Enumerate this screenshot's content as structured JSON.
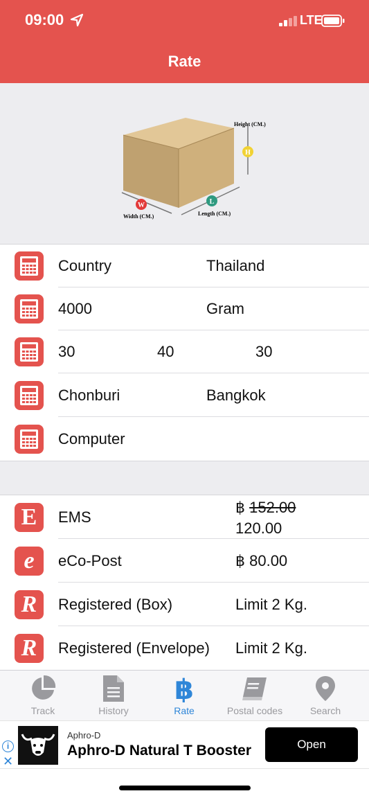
{
  "status_bar": {
    "time": "09:00",
    "network": "LTE"
  },
  "header": {
    "title": "Rate"
  },
  "hero": {
    "height_label": "Height (CM.)",
    "width_label": "Width (CM.)",
    "length_label": "Length (CM.)",
    "h_badge": "H",
    "w_badge": "W",
    "l_badge": "L",
    "box_color": "#c9ac78"
  },
  "form": {
    "country": {
      "label": "Country",
      "value": "Thailand"
    },
    "weight": {
      "value": "4000",
      "unit": "Gram"
    },
    "dimensions": {
      "width": "30",
      "length": "40",
      "height": "30"
    },
    "route": {
      "origin": "Chonburi",
      "destination": "Bangkok"
    },
    "item_type": {
      "value": "Computer"
    }
  },
  "rates": {
    "ems": {
      "icon": "E",
      "name": "EMS",
      "currency": "฿",
      "old_price": "152.00",
      "price": "120.00"
    },
    "eco_post": {
      "icon": "e",
      "name": "eCo-Post",
      "price": "฿ 80.00"
    },
    "registered_box": {
      "icon": "R",
      "name": "Registered (Box)",
      "price": "Limit 2 Kg."
    },
    "registered_envelope": {
      "icon": "R",
      "name": "Registered (Envelope)",
      "price": "Limit 2 Kg."
    }
  },
  "tabs": [
    {
      "label": "Track",
      "icon": "pie-chart-icon",
      "active": false
    },
    {
      "label": "History",
      "icon": "document-icon",
      "active": false
    },
    {
      "label": "Rate",
      "icon": "bitcoin-icon",
      "active": true
    },
    {
      "label": "Postal codes",
      "icon": "book-icon",
      "active": false
    },
    {
      "label": "Search",
      "icon": "map-pin-icon",
      "active": false
    }
  ],
  "ad": {
    "brand": "Aphro-D",
    "title": "Aphro-D Natural T Booster",
    "button": "Open"
  },
  "colors": {
    "accent": "#e4534e",
    "active_tab": "#2f86d8",
    "inactive_tab": "#9a9a9e",
    "background": "#ededf0"
  }
}
